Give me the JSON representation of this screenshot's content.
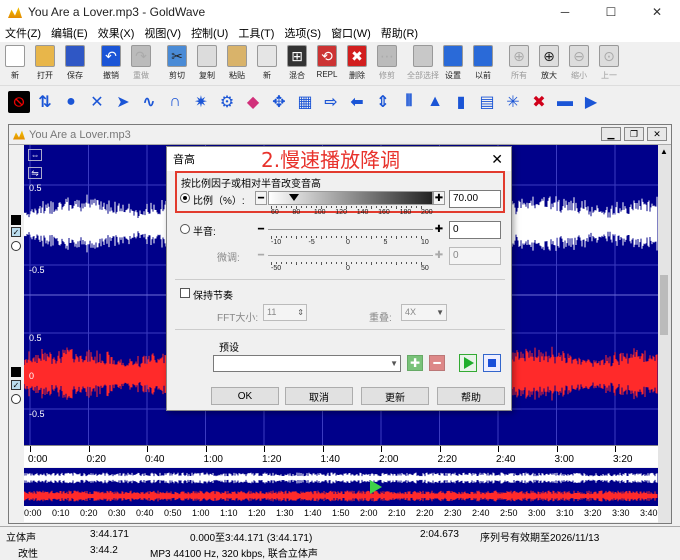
{
  "window": {
    "title": "You Are a Lover.mp3 - GoldWave"
  },
  "menu": [
    "文件(Z)",
    "编辑(E)",
    "效果(X)",
    "视图(V)",
    "控制(U)",
    "工具(T)",
    "选项(S)",
    "窗口(W)",
    "帮助(R)"
  ],
  "toolbar": [
    {
      "label": "新",
      "icon": "new-file-icon",
      "enabled": true
    },
    {
      "label": "打开",
      "icon": "open-folder-icon",
      "enabled": true
    },
    {
      "label": "保存",
      "icon": "save-icon",
      "enabled": true
    },
    {
      "label": "撤销",
      "icon": "undo-icon",
      "enabled": true
    },
    {
      "label": "重做",
      "icon": "redo-icon",
      "enabled": false
    },
    {
      "label": "剪切",
      "icon": "cut-icon",
      "enabled": true
    },
    {
      "label": "复制",
      "icon": "copy-icon",
      "enabled": true
    },
    {
      "label": "粘贴",
      "icon": "paste-icon",
      "enabled": true
    },
    {
      "label": "新",
      "icon": "paste-new-icon",
      "enabled": true
    },
    {
      "label": "混合",
      "icon": "mix-icon",
      "enabled": true
    },
    {
      "label": "REPL",
      "icon": "replace-icon",
      "enabled": true
    },
    {
      "label": "删除",
      "icon": "delete-icon",
      "enabled": true
    },
    {
      "label": "修剪",
      "icon": "trim-icon",
      "enabled": false
    },
    {
      "label": "全部选择",
      "icon": "select-all-icon",
      "enabled": false
    },
    {
      "label": "设置",
      "icon": "set-icon",
      "enabled": true
    },
    {
      "label": "以前",
      "icon": "previous-icon",
      "enabled": true
    },
    {
      "label": "所有",
      "icon": "zoom-all-icon",
      "enabled": false
    },
    {
      "label": "放大",
      "icon": "zoom-in-icon",
      "enabled": true
    },
    {
      "label": "缩小",
      "icon": "zoom-out-icon",
      "enabled": false
    },
    {
      "label": "上一",
      "icon": "zoom-prev-icon",
      "enabled": false
    }
  ],
  "document": {
    "title": "You Are a Lover.mp3",
    "amp_labels": [
      "0.5",
      "-0.5",
      "0.5",
      "0",
      "-0.5"
    ],
    "ruler": [
      "0:00",
      "0:20",
      "0:40",
      "1:00",
      "1:20",
      "1:40",
      "2:00",
      "2:20",
      "2:40",
      "3:00",
      "3:20"
    ],
    "overview_ruler": [
      "0:00",
      "0:10",
      "0:20",
      "0:30",
      "0:40",
      "0:50",
      "1:00",
      "1:10",
      "1:20",
      "1:30",
      "1:40",
      "1:50",
      "2:00",
      "2:10",
      "2:20",
      "2:30",
      "2:40",
      "2:50",
      "3:00",
      "3:10",
      "3:20",
      "3:30",
      "3:40"
    ]
  },
  "dialog": {
    "title": "音高",
    "annotation": "2.慢速播放降调",
    "group_label": "按比例因子或相对半音改变音高",
    "ratio_label": "比例（%）:",
    "ratio_value": "70.00",
    "ratio_scale": [
      "60",
      "80",
      "100",
      "120",
      "140",
      "160",
      "180",
      "200"
    ],
    "semitone_label": "半音:",
    "semitone_value": "0",
    "semitone_scale": [
      "-10",
      "-5",
      "0",
      "5",
      "10"
    ],
    "fine_label": "微调:",
    "fine_value": "0",
    "fine_scale": [
      "-50",
      "0",
      "50"
    ],
    "keep_tempo_label": "保持节奏",
    "fft_label": "FFT大小:",
    "fft_value": "11",
    "overlap_label": "重叠:",
    "overlap_value": "4X",
    "preset_label": "预设",
    "buttons": {
      "ok": "OK",
      "cancel": "取消",
      "update": "更新",
      "help": "帮助"
    }
  },
  "status": {
    "channel": "立体声",
    "duration": "3:44.171",
    "selection": "0.000至3:44.171 (3:44.171)",
    "position": "2:04.673",
    "license": "序列号有效期至2026/11/13",
    "modified": "改性",
    "duration2": "3:44.2",
    "format": "MP3 44100 Hz, 320 kbps, 联合立体声"
  },
  "colors": {
    "wave_bg": "#00008a",
    "left_channel": "#ffffff",
    "right_channel": "#ff2a2a",
    "annotation": "#e8322b",
    "dialog_bg": "#f0f0f0"
  }
}
